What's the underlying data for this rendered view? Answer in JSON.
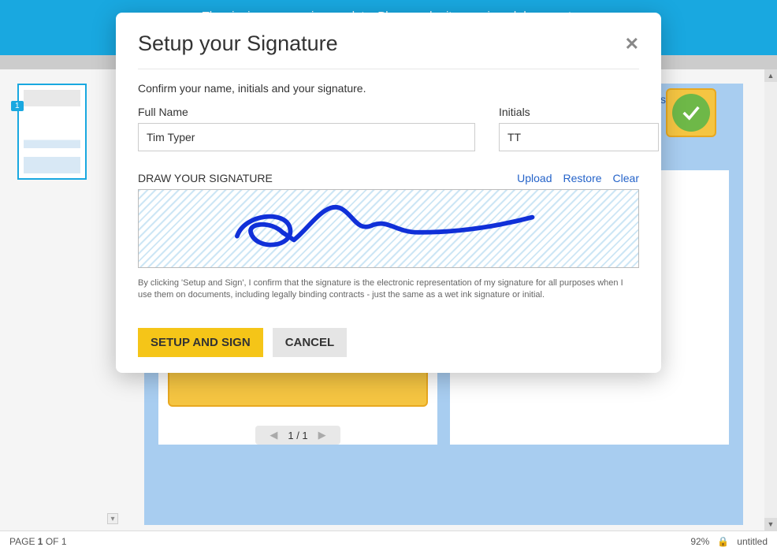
{
  "banner": {
    "message": "The signing process is complete. Please submit your signed document."
  },
  "background": {
    "agreement_fragment": "is Agreement is",
    "thumb_number": "1",
    "page_current": "1",
    "page_sep": " / ",
    "page_total": "1"
  },
  "status": {
    "page_prefix": "PAGE ",
    "page_num": "1",
    "page_suffix": " OF 1",
    "zoom": "92%",
    "doc_name": "untitled"
  },
  "modal": {
    "title": "Setup your Signature",
    "confirm": "Confirm your name, initials and your signature.",
    "full_name_label": "Full Name",
    "full_name_value": "Tim Typer",
    "initials_label": "Initials",
    "initials_value": "TT",
    "draw_label": "DRAW YOUR SIGNATURE",
    "upload": "Upload",
    "restore": "Restore",
    "clear": "Clear",
    "disclaimer": "By clicking 'Setup and Sign', I confirm that the signature is the electronic representation of my signature for all purposes when I use them on documents, including legally binding contracts - just the same as a wet ink signature or initial.",
    "setup_btn": "SETUP AND SIGN",
    "cancel_btn": "CANCEL"
  }
}
